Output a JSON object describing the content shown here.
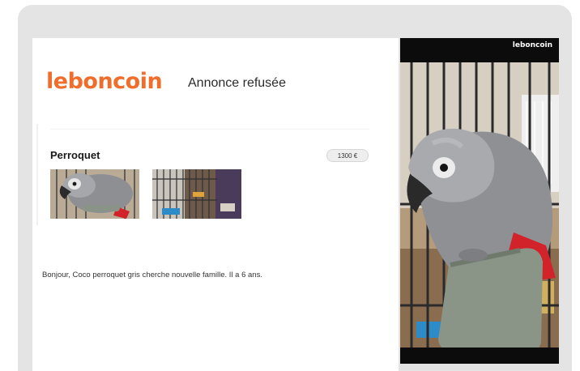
{
  "email": {
    "brand": "leboncoin",
    "status_title": "Annonce refusée",
    "listing": {
      "title": "Perroquet",
      "price": "1300 €",
      "description": "Bonjour, Coco perroquet gris cherche nouvelle famille. Il a 6 ans."
    },
    "images": [
      {
        "icon": "grey-parrot-photo"
      },
      {
        "icon": "birdcage-photo"
      }
    ]
  },
  "preview": {
    "watermark": "leboncoin",
    "icon": "grey-parrot-photo"
  },
  "colors": {
    "brand_orange": "#f06d2b",
    "frame_grey": "#e4e4e4",
    "price_pill": "#eeeeee"
  }
}
